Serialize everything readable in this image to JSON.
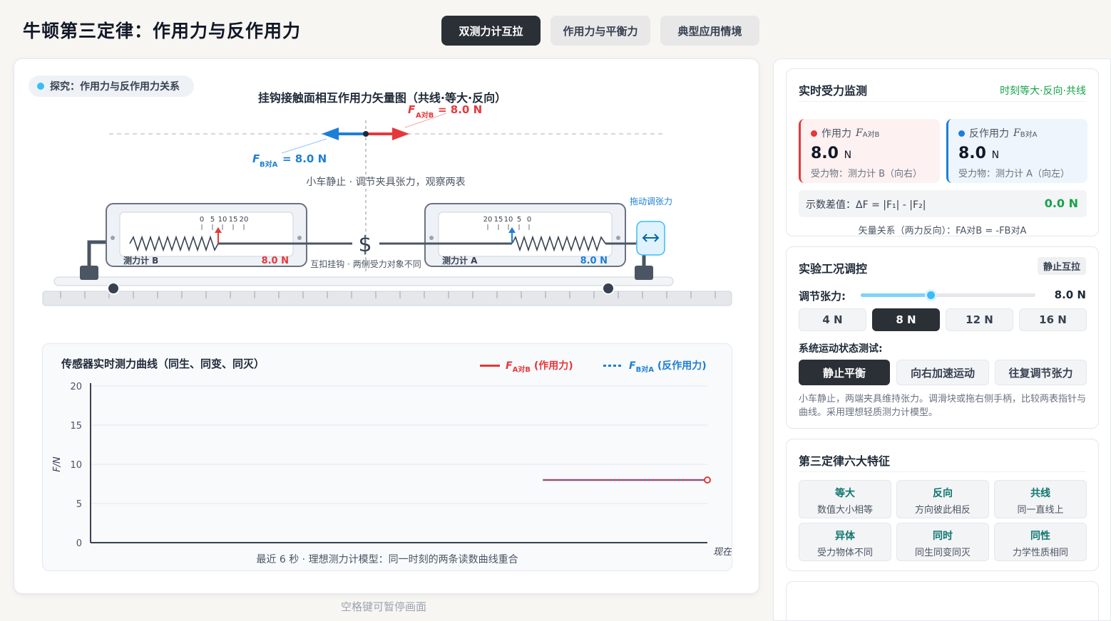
{
  "header": {
    "title": "牛顿第三定律：作用力与反作用力"
  },
  "tabs": [
    {
      "label": "双测力计互拉",
      "active": true
    },
    {
      "label": "作用力与平衡力",
      "active": false
    },
    {
      "label": "典型应用情境",
      "active": false
    }
  ],
  "scene": {
    "explore_label": "探究：作用力与反作用力关系",
    "vector_title": "挂钩接触面相互作用力矢量图（共线·等大·反向）",
    "fab_label": "F",
    "fab_sub": "A对B",
    "fab_value": "= 8.0 N",
    "fba_label": "F",
    "fba_sub": "B对A",
    "fba_value": "= 8.0 N",
    "status_text": "小车静止 · 调节夹具张力，观察两表",
    "meter_b_name": "测力计 B",
    "meter_b_value": "8.0 N",
    "meter_b_ticks": [
      "0",
      "5",
      "10",
      "15",
      "20"
    ],
    "meter_a_name": "测力计 A",
    "meter_a_value": "8.0 N",
    "meter_a_ticks": [
      "20",
      "15",
      "10",
      "5",
      "0"
    ],
    "hook_note": "互扣挂钩 · 两侧受力对象不同",
    "drag_hint": "拖动调张力",
    "handle_icon": "left-right-arrow-icon"
  },
  "chart": {
    "title": "传感器实时测力曲线（同生、同变、同灭）",
    "legend_a": "F",
    "legend_a_sub": "A对B",
    "legend_a_text": "(作用力)",
    "legend_b": "F",
    "legend_b_sub": "B对A",
    "legend_b_text": "(反作用力)",
    "ylabel": "F/N",
    "xlabel_now": "现在",
    "caption": "最近 6 秒 · 理想测力计模型：同一时刻的两条读数曲线重合",
    "colors": {
      "action": "#e5383b",
      "reaction": "#1d7fd6"
    }
  },
  "chart_data": {
    "type": "line",
    "xlabel": "",
    "ylabel": "F/N",
    "ylim": [
      0,
      20
    ],
    "yticks": [
      0,
      5,
      10,
      15,
      20
    ],
    "xlim": [
      -6,
      0
    ],
    "grid": true,
    "legend_position": "top-right",
    "series": [
      {
        "name": "FA对B (作用力)",
        "x": [
          -1.6,
          0
        ],
        "values": [
          8.0,
          8.0
        ]
      },
      {
        "name": "FB对A (反作用力)",
        "x": [
          -1.6,
          0
        ],
        "values": [
          8.0,
          8.0
        ]
      }
    ]
  },
  "pause_hint": "空格键可暂停画面",
  "monitor": {
    "title": "实时受力监测",
    "badge": "时刻等大·反向·共线",
    "action_label": "作用力",
    "action_sym": "F",
    "action_sub": "A对B",
    "action_value": "8.0",
    "action_unit": "N",
    "action_target": "受力物：测力计 B（向右）",
    "reaction_label": "反作用力",
    "reaction_sym": "F",
    "reaction_sub": "B对A",
    "reaction_value": "8.0",
    "reaction_unit": "N",
    "reaction_target": "受力物：测力计 A（向左）",
    "diff_label": "示数差值：ΔF = |F₁| - |F₂|",
    "diff_value": "0.0 N",
    "vector_relation": "矢量关系（两力反向）：FA对B = -FB对A"
  },
  "control": {
    "title": "实验工况调控",
    "state_badge": "静止互拉",
    "tension_label": "调节张力:",
    "tension_value": "8.0 N",
    "tension_level": 0.4,
    "presets": [
      "4 N",
      "8 N",
      "12 N",
      "16 N"
    ],
    "motion_label": "系统运动状态测试:",
    "motions": [
      "静止平衡",
      "向右加速运动",
      "往复调节张力"
    ],
    "description": "小车静止，两端夹具维持张力。调滑块或拖右侧手柄，比较两表指针与曲线。采用理想轻质测力计模型。"
  },
  "features": {
    "title": "第三定律六大特征",
    "items": [
      {
        "head": "等大",
        "desc": "数值大小相等"
      },
      {
        "head": "反向",
        "desc": "方向彼此相反"
      },
      {
        "head": "共线",
        "desc": "同一直线上"
      },
      {
        "head": "异体",
        "desc": "受力物体不同"
      },
      {
        "head": "同时",
        "desc": "同生同变同灭"
      },
      {
        "head": "同性",
        "desc": "力学性质相同"
      }
    ]
  }
}
